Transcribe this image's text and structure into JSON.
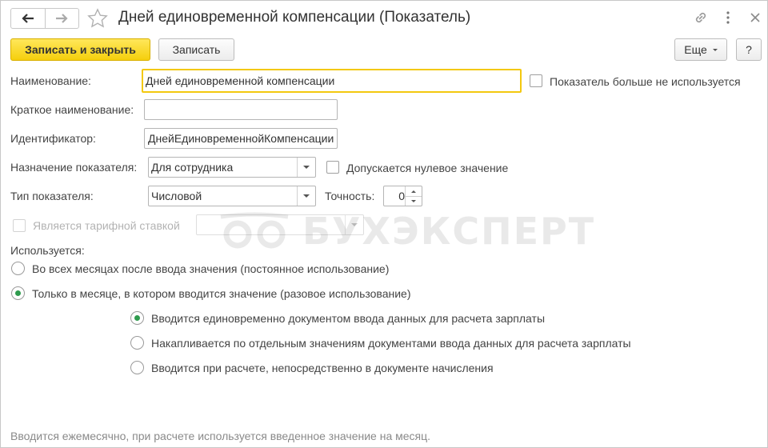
{
  "window": {
    "title": "Дней единовременной компенсации (Показатель)"
  },
  "toolbar": {
    "save_close_label": "Записать и закрыть",
    "save_label": "Записать",
    "more_label": "Еще",
    "help_label": "?"
  },
  "form": {
    "name_label": "Наименование:",
    "name_value": "Дней единовременной компенсации",
    "not_used_label": "Показатель больше не используется",
    "short_name_label": "Краткое наименование:",
    "short_name_value": "",
    "identifier_label": "Идентификатор:",
    "identifier_value": "ДнейЕдиновременнойКомпенсации",
    "purpose_label": "Назначение показателя:",
    "purpose_value": "Для сотрудника",
    "zero_allowed_label": "Допускается нулевое значение",
    "type_label": "Тип показателя:",
    "type_value": "Числовой",
    "precision_label": "Точность:",
    "precision_value": "0",
    "tariff_label": "Является тарифной ставкой",
    "used_label": "Используется:",
    "usage_options": [
      "Во всех месяцах после ввода значения (постоянное использование)",
      "Только в месяце, в котором вводится значение (разовое использование)"
    ],
    "entry_options": [
      "Вводится единовременно документом ввода данных для расчета зарплаты",
      "Накапливается по отдельным значениям документами ввода данных для расчета зарплаты",
      "Вводится при расчете, непосредственно в документе начисления"
    ]
  },
  "watermark": {
    "text": "БУХЭКСПЕРТ"
  },
  "footer": {
    "hint": "Вводится ежемесячно, при расчете используется введенное значение на месяц."
  },
  "colors": {
    "accent_yellow": "#f5cf0c",
    "focus_border": "#f3c80f",
    "radio_dot": "#2f9b4e"
  }
}
